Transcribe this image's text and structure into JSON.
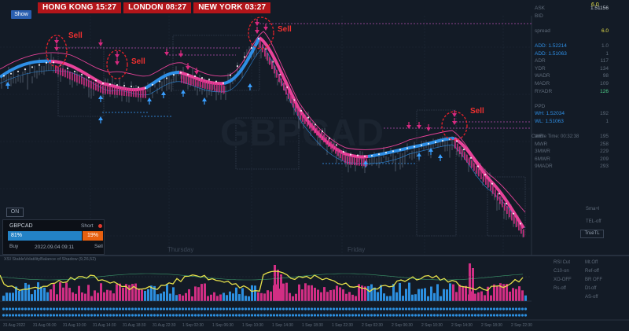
{
  "clocks": [
    {
      "city": "HONG KONG",
      "time": "15:27"
    },
    {
      "city": "LONDON",
      "time": "08:27"
    },
    {
      "city": "NEW YORK",
      "time": "03:27"
    }
  ],
  "show_button": "Show",
  "on_button": "ON",
  "symbol_watermark": "GBPCAD",
  "spread_top": "6.0",
  "right_panel": [
    {
      "label": "ASK",
      "value": "1.51156"
    },
    {
      "label": "BID",
      "value": ""
    },
    {
      "label": "",
      "value": ""
    },
    {
      "label": "spread",
      "value": "6.0"
    },
    {
      "label": "",
      "value": ""
    },
    {
      "label": "ADD: 1.52214",
      "value": "1.0"
    },
    {
      "label": "ADD: 1.51063",
      "value": "1"
    },
    {
      "label": "ADR",
      "value": "117"
    },
    {
      "label": "YDR",
      "value": "134"
    },
    {
      "label": "WADR",
      "value": "98"
    },
    {
      "label": "MADR",
      "value": "109"
    },
    {
      "label": "RYADR",
      "value": "126"
    },
    {
      "label": "",
      "value": ""
    },
    {
      "label": "PPD",
      "value": ""
    },
    {
      "label": "WH: 1.52034",
      "value": "192"
    },
    {
      "label": "WL: 1.51063",
      "value": "1"
    },
    {
      "label": "",
      "value": ""
    },
    {
      "label": "WR",
      "value": "195"
    },
    {
      "label": "MWR",
      "value": "258"
    },
    {
      "label": "3MWR",
      "value": "229"
    },
    {
      "label": "6MWR",
      "value": "209"
    },
    {
      "label": "9MADR",
      "value": "293"
    }
  ],
  "candle_time": "Candle Time: 00:32:38",
  "trade_panel": {
    "symbol": "GBPCAD",
    "direction": "Short",
    "buy_pct": "81%",
    "sell_pct": "19%",
    "buy_label": "Buy",
    "sell_label": "Sell",
    "datetime": "2022.09.04 09:11"
  },
  "signals": {
    "sell_text": "Sell"
  },
  "day_labels": [
    "Thursday",
    "Friday"
  ],
  "indicator_title": "XSI StableVolatilityBalance of Shadow (9,26,52)",
  "indicator_panel": [
    {
      "a": "RSI Cut",
      "b": "Mt.Off"
    },
    {
      "a": "C10-on",
      "b": "Ref-off"
    },
    {
      "a": "XO-OFF",
      "b": "BR OFF"
    },
    {
      "a": "Rs-off",
      "b": "Dt-off"
    },
    {
      "a": "",
      "b": "AS-off"
    }
  ],
  "small_labels": {
    "tel": "TEL-off",
    "sma": "Sma+I",
    "truetl": "TrueTL"
  },
  "x_labels": [
    "31 Aug 2022",
    "31 Aug 06:30",
    "31 Aug 10:30",
    "31 Aug 14:30",
    "31 Aug 18:30",
    "31 Aug 22:30",
    "1 Sep 02:30",
    "1 Sep 06:30",
    "1 Sep 10:30",
    "1 Sep 14:30",
    "1 Sep 18:30",
    "1 Sep 22:30",
    "2 Sep 02:30",
    "2 Sep 06:30",
    "2 Sep 10:30",
    "2 Sep 14:30",
    "2 Sep 18:30",
    "2 Sep 22:30"
  ],
  "colors": {
    "background": "#131b26",
    "price_line_pink": "#e8439a",
    "price_line_blue": "#2e8fe6",
    "sell_marker": "#d6297f",
    "buy_marker": "#3a9fff",
    "hist_pink": "#d12e84",
    "hist_blue": "#2c8fe0",
    "osc_yellow": "#e8e24a",
    "sell_red": "#f03030"
  }
}
